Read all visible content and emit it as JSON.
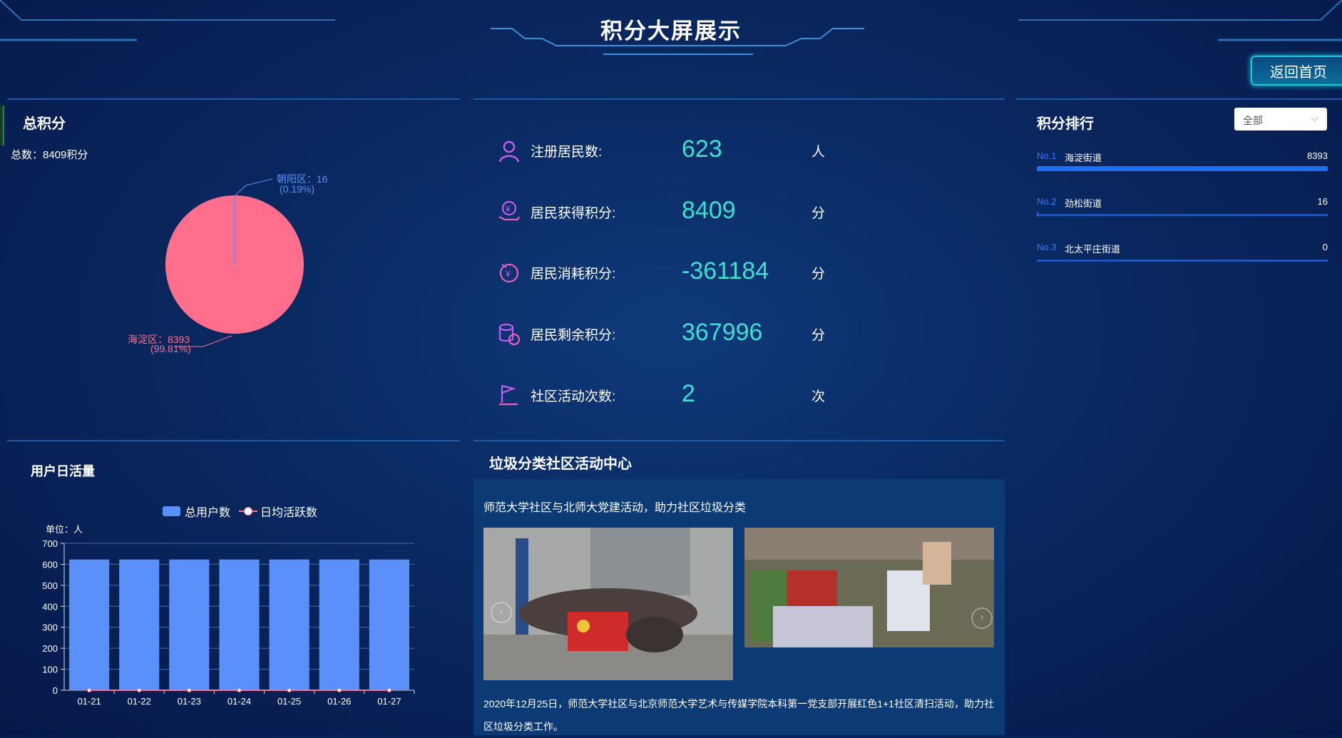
{
  "header": {
    "title": "积分大屏展示",
    "home_button": "返回首页"
  },
  "total_points": {
    "title": "总积分",
    "summary": "总数：8409积分",
    "chart_data": {
      "type": "pie",
      "slices": [
        {
          "label": "海淀区",
          "value": 8393,
          "percent": "99.81%",
          "color": "#ff6f8c"
        },
        {
          "label": "朝阳区",
          "value": 16,
          "percent": "0.19%",
          "color": "#5b8ff9"
        }
      ],
      "label_texts": [
        "海淀区：8393",
        "(99.81%)",
        "朝阳区：16",
        "(0.19%)"
      ]
    }
  },
  "stats": [
    {
      "icon": "user-icon",
      "label": "注册居民数:",
      "value": "623",
      "unit": "人"
    },
    {
      "icon": "hand-yen-icon",
      "label": "居民获得积分:",
      "value": "8409",
      "unit": "分"
    },
    {
      "icon": "consume-icon",
      "label": "居民消耗积分:",
      "value": "-361184",
      "unit": "分"
    },
    {
      "icon": "coins-icon",
      "label": "居民剩余积分:",
      "value": "367996",
      "unit": "分"
    },
    {
      "icon": "flag-icon",
      "label": "社区活动次数:",
      "value": "2",
      "unit": "次"
    }
  ],
  "ranking": {
    "title": "积分排行",
    "filter": "全部",
    "items": [
      {
        "no": "No.1",
        "name": "海淀街道",
        "value": 8393,
        "value_text": "8393"
      },
      {
        "no": "No.2",
        "name": "劲松街道",
        "value": 16,
        "value_text": "16"
      },
      {
        "no": "No.3",
        "name": "北太平庄街道",
        "value": 0,
        "value_text": "0"
      }
    ]
  },
  "daily_active": {
    "title": "用户日活量",
    "legend": [
      "总用户数",
      "日均活跃数"
    ],
    "unit_label": "单位：人",
    "chart_data": {
      "type": "bar",
      "categories": [
        "01-21",
        "01-22",
        "01-23",
        "01-24",
        "01-25",
        "01-26",
        "01-27"
      ],
      "series": [
        {
          "name": "总用户数",
          "type": "bar",
          "values": [
            623,
            623,
            623,
            623,
            623,
            623,
            623
          ],
          "color": "#5b8ff9"
        },
        {
          "name": "日均活跃数",
          "type": "line",
          "values": [
            0,
            0,
            0,
            0,
            0,
            0,
            0
          ],
          "color": "#ff6f8c"
        }
      ],
      "ylim": [
        0,
        700
      ],
      "yticks": [
        0,
        100,
        200,
        300,
        400,
        500,
        600,
        700
      ],
      "ytick_labels": [
        "0",
        "100",
        "200",
        "300",
        "400",
        "500",
        "600",
        "700"
      ]
    }
  },
  "activity": {
    "title": "垃圾分类社区活动中心",
    "headline": "师范大学社区与北师大党建活动，助力社区垃圾分类",
    "description_line1": "2020年12月25日，师范大学社区与北京师范大学艺术与传媒学院本科第一党支部开展红色1+1社区清扫活动，助力社",
    "description_line2": "区垃圾分类工作。"
  }
}
